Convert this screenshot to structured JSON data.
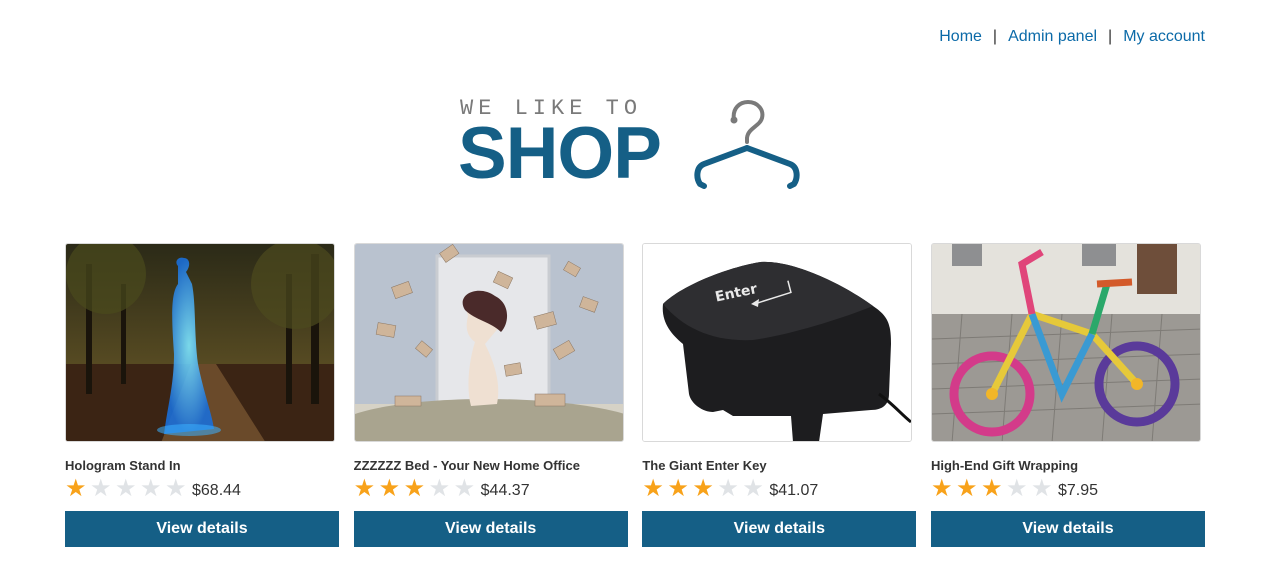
{
  "nav": {
    "items": [
      {
        "label": "Home"
      },
      {
        "label": "Admin panel"
      },
      {
        "label": "My account"
      }
    ],
    "separator": "|"
  },
  "logo": {
    "tagline": "WE LIKE TO",
    "word": "SHOP",
    "color": "#155f86"
  },
  "products": [
    {
      "name": "Hologram Stand In",
      "rating": 1,
      "price": "$68.44",
      "button": "View details"
    },
    {
      "name": "ZZZZZZ Bed - Your New Home Office",
      "rating": 3,
      "price": "$44.37",
      "button": "View details"
    },
    {
      "name": "The Giant Enter Key",
      "rating": 3,
      "price": "$41.07",
      "button": "View details",
      "image_text": "Enter"
    },
    {
      "name": "High-End Gift Wrapping",
      "rating": 3,
      "price": "$7.95",
      "button": "View details"
    }
  ],
  "colors": {
    "accent": "#155f86",
    "link": "#0b6aa8",
    "star_on": "#f8a21a",
    "star_off": "#e0e3e6"
  }
}
